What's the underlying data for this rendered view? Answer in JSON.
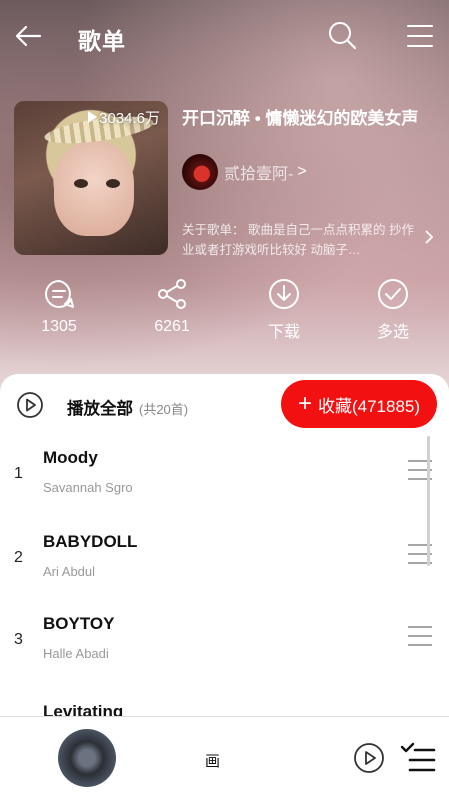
{
  "header": {
    "title": "歌单"
  },
  "playlist": {
    "play_count": "3034.6万",
    "title": "开口沉醉 • 慵懒迷幻的欧美女声",
    "creator": "贰拾壹阿-",
    "creator_arrow": ">",
    "description": "关于歌单： 歌曲是自己一点点积累的 抄作业或者打游戏听比较好 动脑子…"
  },
  "actions": [
    {
      "label": "1305",
      "icon": "comment-icon"
    },
    {
      "label": "6261",
      "icon": "share-icon"
    },
    {
      "label": "下载",
      "icon": "download-icon"
    },
    {
      "label": "多选",
      "icon": "multi-select-icon"
    }
  ],
  "list": {
    "play_all_label": "播放全部",
    "play_all_count": "(共20首)",
    "collect_label": "收藏(471885)",
    "collect_plus": "+",
    "songs": [
      {
        "index": "1",
        "name": "Moody",
        "artist": "Savannah Sgro"
      },
      {
        "index": "2",
        "name": "BABYDOLL",
        "artist": "Ari Abdul"
      },
      {
        "index": "3",
        "name": "BOYTOY",
        "artist": "Halle Abadi"
      },
      {
        "index": "",
        "name": "Levitating",
        "artist": ""
      }
    ]
  },
  "player": {
    "title": "画"
  },
  "colors": {
    "accent": "#f21010"
  }
}
